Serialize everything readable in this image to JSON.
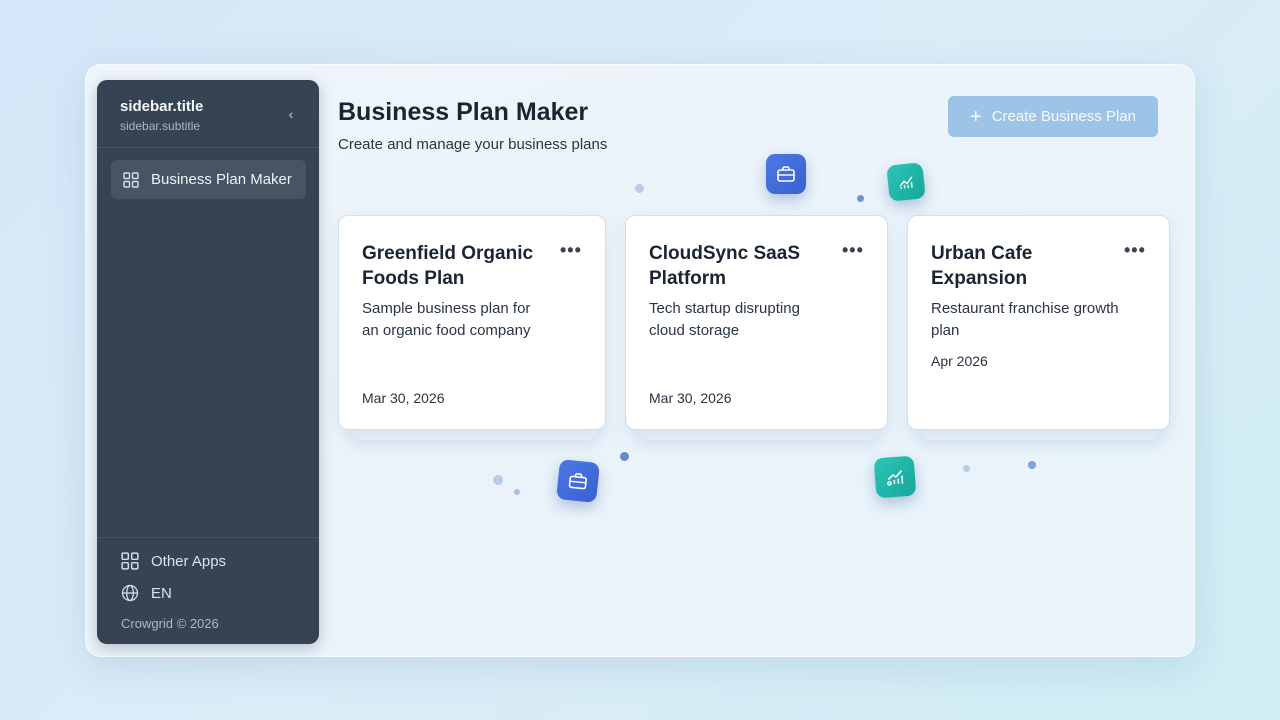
{
  "sidebar": {
    "title": "sidebar.title",
    "subtitle": "sidebar.subtitle",
    "collapse_glyph": "‹",
    "nav": [
      {
        "label": "Business Plan Maker",
        "icon": "grid-icon"
      }
    ],
    "footer": {
      "other_apps": "Other Apps",
      "language": "EN",
      "copyright": "Crowgrid © 2026"
    }
  },
  "header": {
    "title": "Business Plan Maker",
    "subtitle": "Create and manage your business plans",
    "create_button": "Create Business Plan"
  },
  "cards": [
    {
      "title": "Greenfield Organic Foods Plan",
      "description": "Sample business plan for an organic food company",
      "date": "Mar 30, 2026",
      "menu": "•••"
    },
    {
      "title": "CloudSync SaaS Platform",
      "description": "Tech startup disrupting cloud storage",
      "date": "Mar 30, 2026",
      "menu": "•••"
    },
    {
      "title": "Urban Cafe Expansion",
      "description": "Restaurant franchise growth plan",
      "date": "Apr 2026",
      "menu": "•••"
    }
  ],
  "colors": {
    "sidebar_bg": "#364352",
    "accent_button": "#9dc4e6",
    "icon_blue": "#3a5fd1",
    "icon_teal": "#14a89b"
  }
}
